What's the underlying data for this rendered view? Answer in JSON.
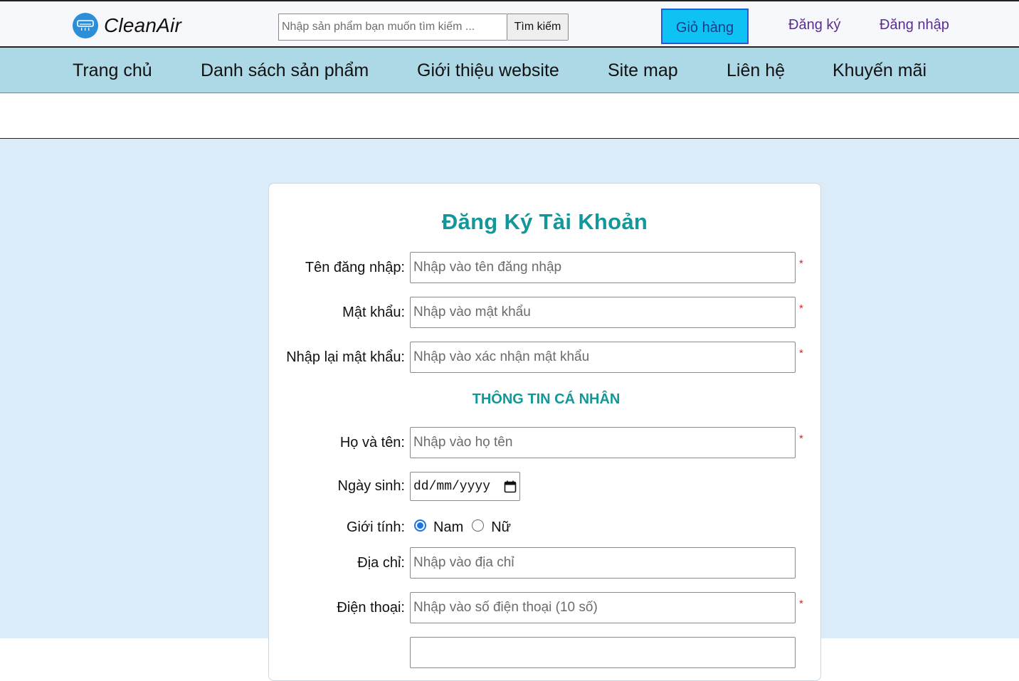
{
  "header": {
    "logo_text": "CleanAir",
    "logo_icon": "air-conditioner-icon",
    "search": {
      "placeholder": "Nhập sản phẩm bạn muốn tìm kiếm ...",
      "value": "",
      "button_label": "Tìm kiếm"
    },
    "cart_label": "Giỏ hàng",
    "register_label": "Đăng ký",
    "login_label": "Đăng nhập"
  },
  "nav": {
    "items": [
      {
        "label": "Trang chủ"
      },
      {
        "label": "Danh sách sản phẩm"
      },
      {
        "label": "Giới thiệu website"
      },
      {
        "label": "Site map"
      },
      {
        "label": "Liên hệ"
      },
      {
        "label": "Khuyến mãi"
      }
    ]
  },
  "form": {
    "title": "Đăng Ký Tài Khoản",
    "section_personal": "THÔNG TIN CÁ NHÂN",
    "required_mark": "*",
    "fields": {
      "username": {
        "label": "Tên đăng nhập:",
        "placeholder": "Nhập vào tên đăng nhập"
      },
      "password": {
        "label": "Mật khẩu:",
        "placeholder": "Nhập vào mật khẩu"
      },
      "confirm_password": {
        "label": "Nhập lại mật khẩu:",
        "placeholder": "Nhập vào xác nhận mật khẩu"
      },
      "fullname": {
        "label": "Họ và tên:",
        "placeholder": "Nhập vào họ tên"
      },
      "birthday": {
        "label": "Ngày sinh:",
        "value": "dd/mm/yyyy"
      },
      "gender": {
        "label": "Giới tính:",
        "options": [
          "Nam",
          "Nữ"
        ],
        "selected": "Nam"
      },
      "address": {
        "label": "Địa chỉ:",
        "placeholder": "Nhập vào địa chỉ"
      },
      "phone": {
        "label": "Điện thoại:",
        "placeholder": "Nhập vào số điện thoại (10 số)"
      }
    }
  },
  "colors": {
    "header_bg": "#f7f8fb",
    "nav_bg": "#add8e6",
    "main_bg": "#dcebf8",
    "accent_teal": "#13979a",
    "cart_bg": "#0ec2f3",
    "link_purple": "#5b2d8e",
    "required_red": "#e02020"
  }
}
